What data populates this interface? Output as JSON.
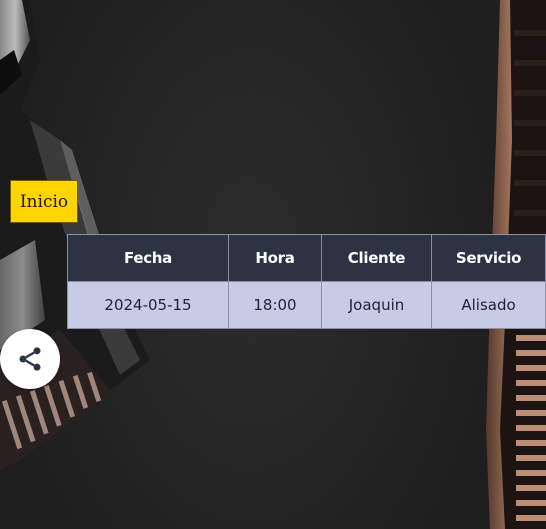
{
  "nav": {
    "home_label": "Inicio"
  },
  "appointments": {
    "headers": [
      "Fecha",
      "Hora",
      "Cliente",
      "Servicio"
    ],
    "rows": [
      [
        "2024-05-15",
        "18:00",
        "Joaquin",
        "Alisado"
      ]
    ]
  },
  "share": {
    "icon": "share-icon"
  },
  "colors": {
    "button_yellow": "#ffd400",
    "table_header": "#2c3443",
    "table_row": "#c6cbe6",
    "background": "#262626"
  }
}
